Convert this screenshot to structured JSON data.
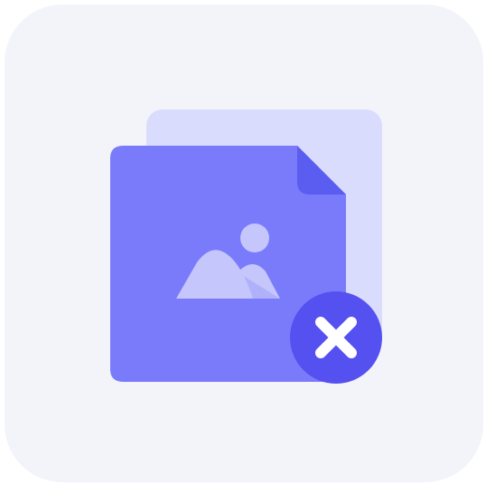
{
  "icon": {
    "name": "image-file-error-icon",
    "badge_icon": "close-icon",
    "colors": {
      "tile_background": "#f2f4f9",
      "back_sheet": "#dadcfd",
      "front_sheet": "#7a7bfb",
      "folded_corner": "#5b5cf0",
      "picture_glyph": "#c5c6fc",
      "picture_glyph_fold": "#b0b1fb",
      "badge": "#5550f0",
      "badge_cross": "#ffffff"
    }
  }
}
